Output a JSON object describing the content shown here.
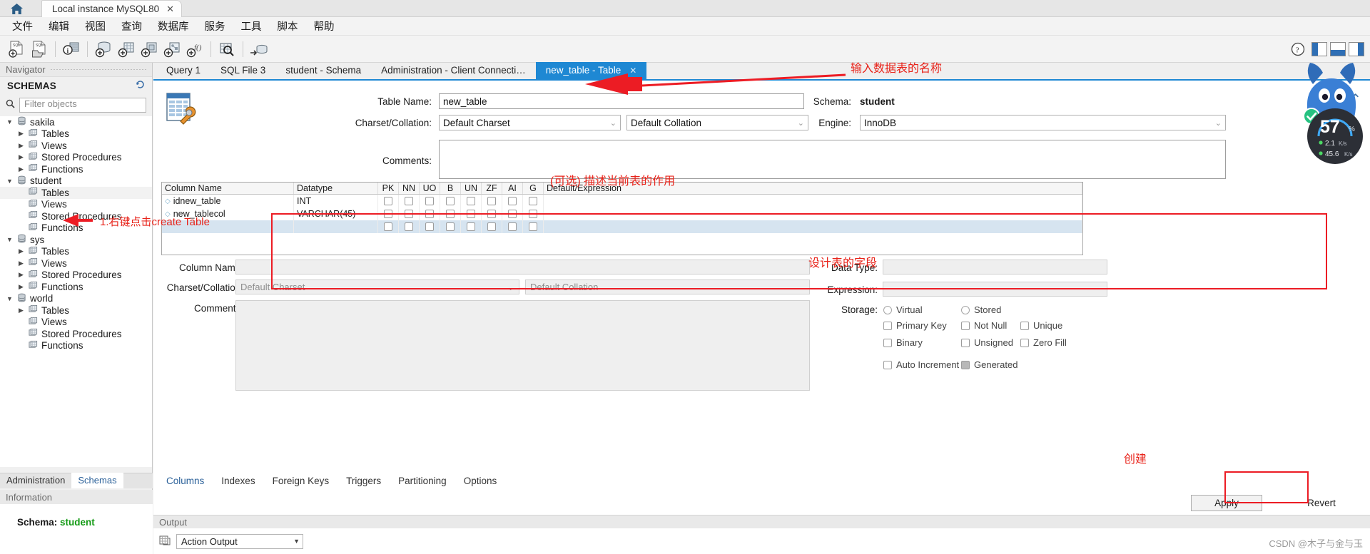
{
  "titlebar": {
    "home_icon": "home-icon",
    "connection_tab": "Local instance MySQL80",
    "close_glyph": "✕"
  },
  "menubar": {
    "items": [
      "文件",
      "编辑",
      "视图",
      "查询",
      "数据库",
      "服务",
      "工具",
      "脚本",
      "帮助"
    ]
  },
  "toolbar": {
    "icons": [
      "new-sql-file-icon",
      "open-sql-file-icon",
      "connection-info-icon",
      "new-schema-icon",
      "new-table-icon",
      "new-view-icon",
      "new-procedure-icon",
      "new-function-icon",
      "search-data-icon",
      "reconnect-server-icon"
    ],
    "right_icons": [
      "help-icon",
      "toggle-sidebar-icon",
      "toggle-output-icon",
      "toggle-secondary-sidebar-icon"
    ]
  },
  "sidebar": {
    "navigator_label": "Navigator",
    "schemas_label": "SCHEMAS",
    "refresh_icon": "refresh-icon",
    "filter_placeholder": "Filter objects",
    "search_icon": "search-icon",
    "tree": [
      {
        "label": "sakila",
        "type": "schema",
        "expanded": true,
        "depth": 0
      },
      {
        "label": "Tables",
        "type": "folder",
        "expanded": false,
        "depth": 1
      },
      {
        "label": "Views",
        "type": "folder",
        "expanded": false,
        "depth": 1
      },
      {
        "label": "Stored Procedures",
        "type": "folder",
        "expanded": false,
        "depth": 1
      },
      {
        "label": "Functions",
        "type": "folder",
        "expanded": false,
        "depth": 1
      },
      {
        "label": "student",
        "type": "schema",
        "expanded": true,
        "depth": 0
      },
      {
        "label": "Tables",
        "type": "folder",
        "expanded": null,
        "depth": 1,
        "selected": true
      },
      {
        "label": "Views",
        "type": "folder",
        "expanded": null,
        "depth": 1
      },
      {
        "label": "Stored Procedures",
        "type": "folder",
        "expanded": null,
        "depth": 1
      },
      {
        "label": "Functions",
        "type": "folder",
        "expanded": null,
        "depth": 1
      },
      {
        "label": "sys",
        "type": "schema",
        "expanded": true,
        "depth": 0
      },
      {
        "label": "Tables",
        "type": "folder",
        "expanded": false,
        "depth": 1
      },
      {
        "label": "Views",
        "type": "folder",
        "expanded": false,
        "depth": 1
      },
      {
        "label": "Stored Procedures",
        "type": "folder",
        "expanded": false,
        "depth": 1
      },
      {
        "label": "Functions",
        "type": "folder",
        "expanded": false,
        "depth": 1
      },
      {
        "label": "world",
        "type": "schema",
        "expanded": true,
        "depth": 0
      },
      {
        "label": "Tables",
        "type": "folder",
        "expanded": false,
        "depth": 1
      },
      {
        "label": "Views",
        "type": "folder",
        "expanded": null,
        "depth": 1
      },
      {
        "label": "Stored Procedures",
        "type": "folder",
        "expanded": null,
        "depth": 1
      },
      {
        "label": "Functions",
        "type": "folder",
        "expanded": null,
        "depth": 1
      }
    ],
    "bottom_tabs": [
      {
        "label": "Administration",
        "active": false
      },
      {
        "label": "Schemas",
        "active": true
      }
    ],
    "information_label": "Information",
    "info_key": "Schema:",
    "info_value": "student"
  },
  "editor": {
    "tabs": [
      {
        "label": "Query 1",
        "active": false
      },
      {
        "label": "SQL File 3",
        "active": false
      },
      {
        "label": "student - Schema",
        "active": false
      },
      {
        "label": "Administration - Client Connecti…",
        "active": false
      },
      {
        "label": "new_table - Table",
        "active": true,
        "close_glyph": "✕"
      }
    ],
    "table_icon": "table-editor-icon",
    "scroll_up_icon": "collapse-chevron-icon",
    "table_name_label": "Table Name:",
    "table_name_value": "new_table",
    "charset_label": "Charset/Collation:",
    "charset_value": "Default Charset",
    "collation_value": "Default Collation",
    "schema_label": "Schema:",
    "schema_value": "student",
    "engine_label": "Engine:",
    "engine_value": "InnoDB",
    "comments_label": "Comments:",
    "comments_value": "",
    "grid": {
      "headers": [
        "Column Name",
        "Datatype",
        "PK",
        "NN",
        "UO",
        "B",
        "UN",
        "ZF",
        "AI",
        "G",
        "Default/Expression"
      ],
      "rows": [
        {
          "name": "idnew_table",
          "datatype": "INT",
          "flags": [
            false,
            false,
            false,
            false,
            false,
            false,
            false,
            false
          ],
          "default": ""
        },
        {
          "name": "new_tablecol",
          "datatype": "VARCHAR(45)",
          "flags": [
            false,
            false,
            false,
            false,
            false,
            false,
            false,
            false
          ],
          "default": ""
        },
        {
          "name": "",
          "datatype": "",
          "flags": [
            false,
            false,
            false,
            false,
            false,
            false,
            false,
            false
          ],
          "default": "",
          "empty": true
        }
      ]
    },
    "detail": {
      "column_name_label": "Column Name:",
      "column_name_value": "",
      "charset_label": "Charset/Collation:",
      "charset_value": "Default Charset",
      "collation_value": "Default Collation",
      "comments_label": "Comments:",
      "comments_value": "",
      "data_type_label": "Data Type:",
      "data_type_value": "",
      "expression_label": "Expression:",
      "expression_value": "",
      "storage_label": "Storage:",
      "storage_options": [
        {
          "label": "Virtual",
          "checked": false
        },
        {
          "label": "Stored",
          "checked": false
        }
      ],
      "checkboxes": [
        {
          "label": "Primary Key",
          "checked": false
        },
        {
          "label": "Not Null",
          "checked": false
        },
        {
          "label": "Unique",
          "checked": false
        },
        {
          "label": "Binary",
          "checked": false
        },
        {
          "label": "Unsigned",
          "checked": false
        },
        {
          "label": "Zero Fill",
          "checked": false
        },
        {
          "label": "Auto Increment",
          "checked": false
        },
        {
          "label": "Generated",
          "checked": true
        }
      ]
    },
    "bottom_tabs": [
      {
        "label": "Columns",
        "active": true
      },
      {
        "label": "Indexes",
        "active": false
      },
      {
        "label": "Foreign Keys",
        "active": false
      },
      {
        "label": "Triggers",
        "active": false
      },
      {
        "label": "Partitioning",
        "active": false
      },
      {
        "label": "Options",
        "active": false
      }
    ],
    "apply_label": "Apply",
    "revert_label": "Revert"
  },
  "output": {
    "title": "Output",
    "action_output_label": "Action Output",
    "grid_icon": "output-grid-icon",
    "dropdown_icon": "chevron-down-icon"
  },
  "annotations": [
    {
      "id": "ann-table-name",
      "text": "输入数据表的名称",
      "color": "#e8231a"
    },
    {
      "id": "ann-comments",
      "text": "(可选) 描述当前表的作用",
      "color": "#e8231a"
    },
    {
      "id": "ann-create-table",
      "text": "1.右键点击create Table",
      "color": "#e8231a"
    },
    {
      "id": "ann-fields",
      "text": "设计表的字段",
      "color": "#e8231a"
    },
    {
      "id": "ann-create",
      "text": "创建",
      "color": "#e8231a"
    }
  ],
  "widget": {
    "percent": "57",
    "percent_unit": "%",
    "up_rate": "2.1",
    "down_rate": "45.6",
    "rate_unit": "K/s"
  },
  "watermark": "CSDN @木子与金与玉",
  "colors": {
    "accent_blue": "#1e88d3",
    "annotation_red": "#e8231a",
    "schema_green": "#159b16",
    "grid_select_blue": "#d6e4f0"
  }
}
